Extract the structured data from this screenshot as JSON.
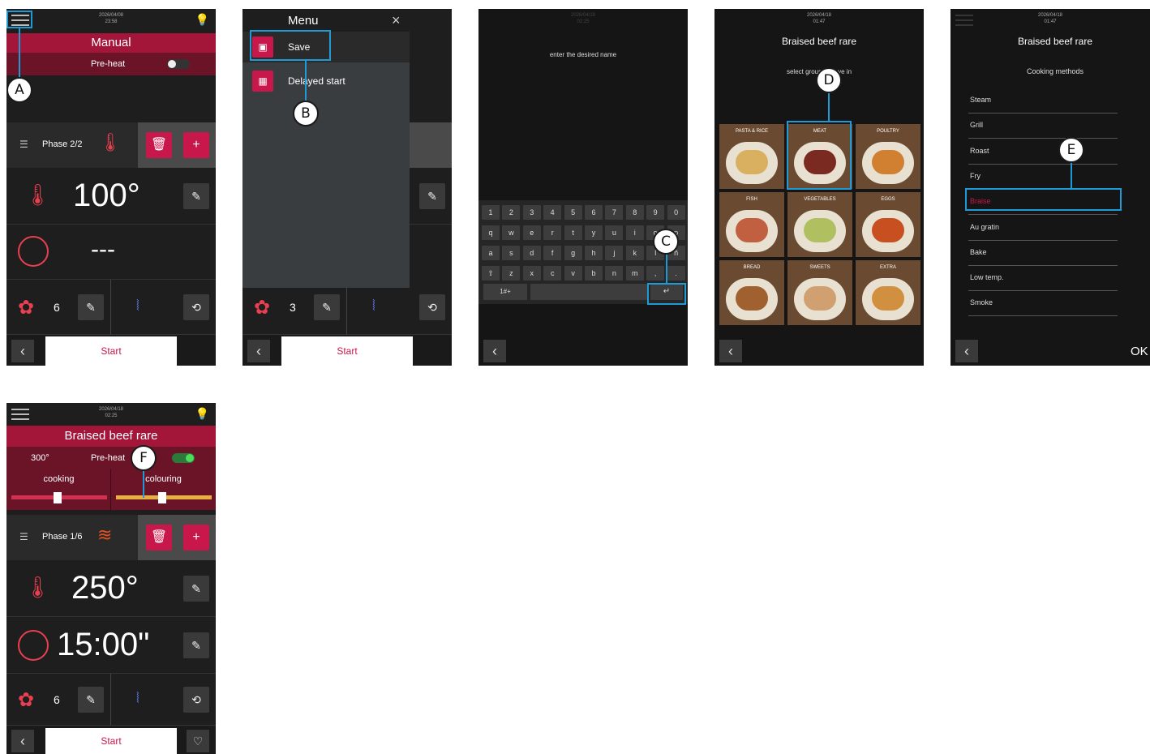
{
  "colors": {
    "accent": "#c8174a",
    "header_red": "#a3163a",
    "callout_line": "#1e9bd7"
  },
  "callouts": [
    "A",
    "B",
    "C",
    "D",
    "E",
    "F"
  ],
  "screen1": {
    "datetime": "2026/04/08\n23:58",
    "title": "Manual",
    "preheat_label": "Pre-heat",
    "phase_label": "Phase 2/2",
    "temperature": "100°",
    "time": "---",
    "fan_speed": "6",
    "start_label": "Start",
    "back_icon": "‹"
  },
  "screen2": {
    "menu_title": "Menu",
    "close_icon": "×",
    "items": [
      {
        "label": "Save",
        "icon": "save-icon"
      },
      {
        "label": "Delayed start",
        "icon": "delayed-start-icon"
      }
    ],
    "fan_speed": "3",
    "start_label": "Start"
  },
  "screen3": {
    "datetime": "2026/04/18\n02:25",
    "prompt": "enter the desired name",
    "keyboard_rows": [
      [
        "1",
        "2",
        "3",
        "4",
        "5",
        "6",
        "7",
        "8",
        "9",
        "0"
      ],
      [
        "q",
        "w",
        "e",
        "r",
        "t",
        "y",
        "u",
        "i",
        "o",
        "p"
      ],
      [
        "a",
        "s",
        "d",
        "f",
        "g",
        "h",
        "j",
        "k",
        "l",
        "ñ"
      ],
      [
        "⇧",
        "z",
        "x",
        "c",
        "v",
        "b",
        "n",
        "m",
        ",",
        "."
      ]
    ],
    "symbols_key": "1#+",
    "enter_key": "↵"
  },
  "screen4": {
    "datetime": "2026/04/18\n01:47",
    "title": "Braised beef rare",
    "subtitle": "select group to save in",
    "groups": [
      "PASTA & RICE",
      "MEAT",
      "POULTRY",
      "FISH",
      "VEGETABLES",
      "EGGS",
      "BREAD",
      "SWEETS",
      "EXTRA"
    ]
  },
  "screen5": {
    "datetime": "2026/04/18\n01:47",
    "title": "Braised beef rare",
    "subtitle": "Cooking methods",
    "methods": [
      "Steam",
      "Grill",
      "Roast",
      "Fry",
      "Braise",
      "Au gratin",
      "Bake",
      "Low temp.",
      "Smoke"
    ],
    "selected_method": "Braise",
    "ok_label": "OK"
  },
  "screen6": {
    "datetime": "2026/04/18\n02:25",
    "title": "Braised beef rare",
    "probe_temp": "300°",
    "preheat_label": "Pre-heat",
    "cooking_label": "cooking",
    "colouring_label": "colouring",
    "phase_label": "Phase 1/6",
    "temperature": "250°",
    "time": "15:00\"",
    "fan_speed": "6",
    "start_label": "Start"
  }
}
